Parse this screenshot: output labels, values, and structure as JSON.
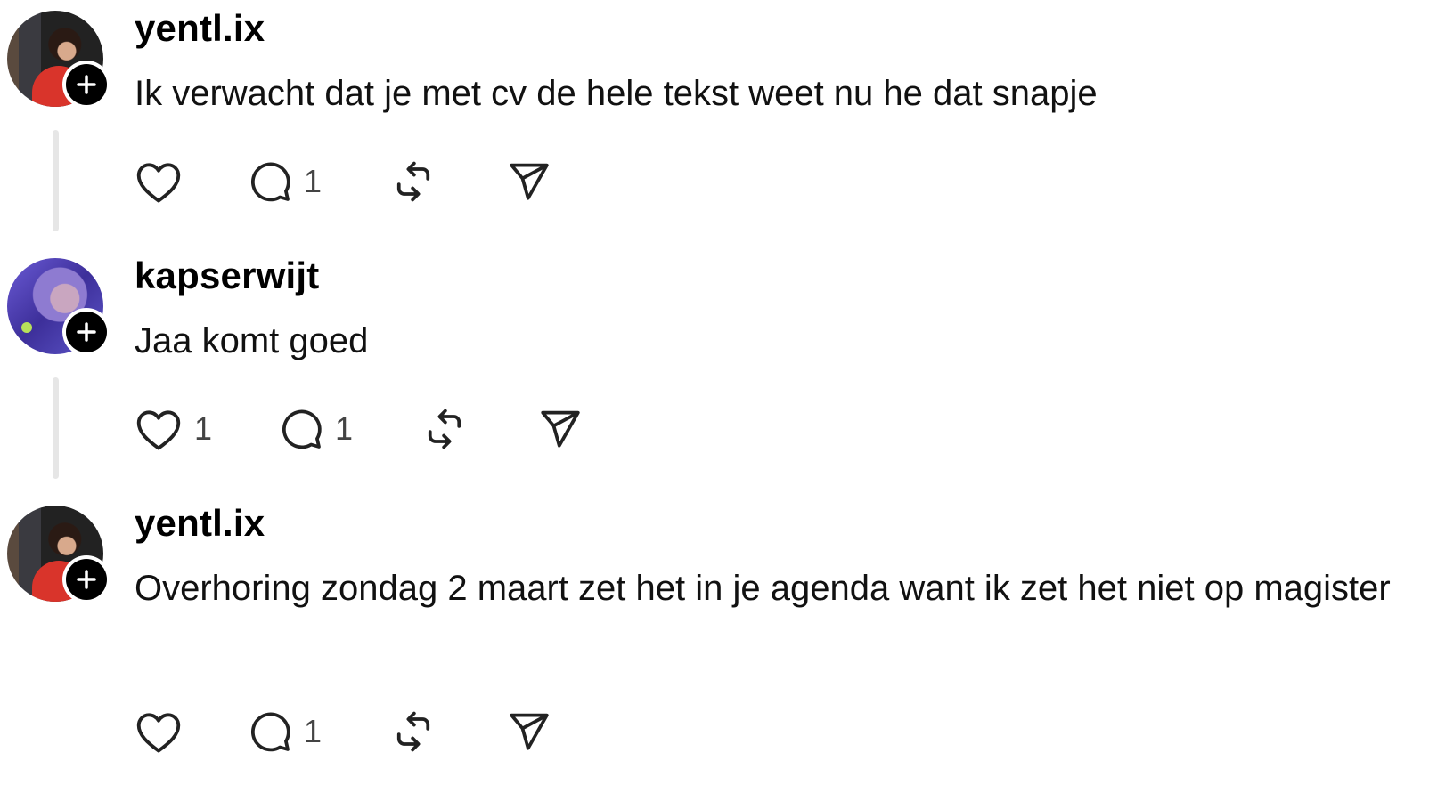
{
  "posts": [
    {
      "username": "yentl.ix",
      "text": "Ik verwacht dat je met cv de hele tekst weet nu he dat snapje",
      "likes": "",
      "replies": "1"
    },
    {
      "username": "kapserwijt",
      "text": "Jaa komt goed",
      "likes": "1",
      "replies": "1"
    },
    {
      "username": "yentl.ix",
      "text": "Overhoring zondag 2 maart zet het in je agenda want ik zet het niet op magister",
      "likes": "",
      "replies": "1"
    }
  ],
  "icons": {
    "like": "heart-icon",
    "reply": "comment-icon",
    "repost": "repost-icon",
    "share": "send-icon",
    "follow": "plus-icon"
  },
  "colors": {
    "text": "#111111",
    "icon": "#222222",
    "thread_line": "#e6e6e6",
    "badge": "#000000"
  }
}
